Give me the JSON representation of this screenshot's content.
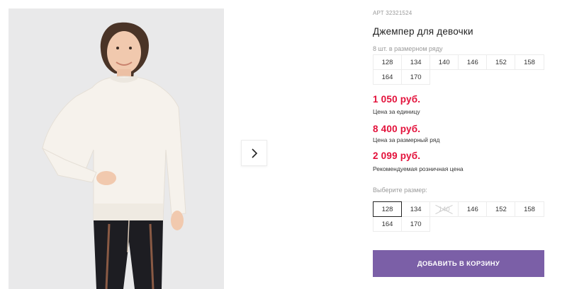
{
  "product": {
    "article": "АРТ 32321524",
    "title": "Джемпер для девочки",
    "row_note": "8 шт. в размерном ряду"
  },
  "size_row": [
    "128",
    "134",
    "140",
    "146",
    "152",
    "158",
    "164",
    "170"
  ],
  "prices": [
    {
      "value": "1 050 руб.",
      "label": "Цена за единицу"
    },
    {
      "value": "8 400 руб.",
      "label": "Цена за размерный ряд"
    },
    {
      "value": "2 099 руб.",
      "label": "Рекомендуемая розничная цена"
    }
  ],
  "size_picker": {
    "label": "Выберите размер:",
    "options": [
      {
        "size": "128",
        "state": "selected"
      },
      {
        "size": "134",
        "state": "available"
      },
      {
        "size": "140",
        "state": "unavailable"
      },
      {
        "size": "146",
        "state": "available"
      },
      {
        "size": "152",
        "state": "available"
      },
      {
        "size": "158",
        "state": "available"
      },
      {
        "size": "164",
        "state": "available"
      },
      {
        "size": "170",
        "state": "available"
      }
    ]
  },
  "cart_button": {
    "label": "ДОБАВИТЬ В КОРЗИНУ"
  },
  "colors": {
    "accent": "#7b5fa7",
    "price": "#e3103a",
    "photo_bg": "#e9e9ea"
  },
  "icons": {
    "next": "chevron-right-icon"
  }
}
